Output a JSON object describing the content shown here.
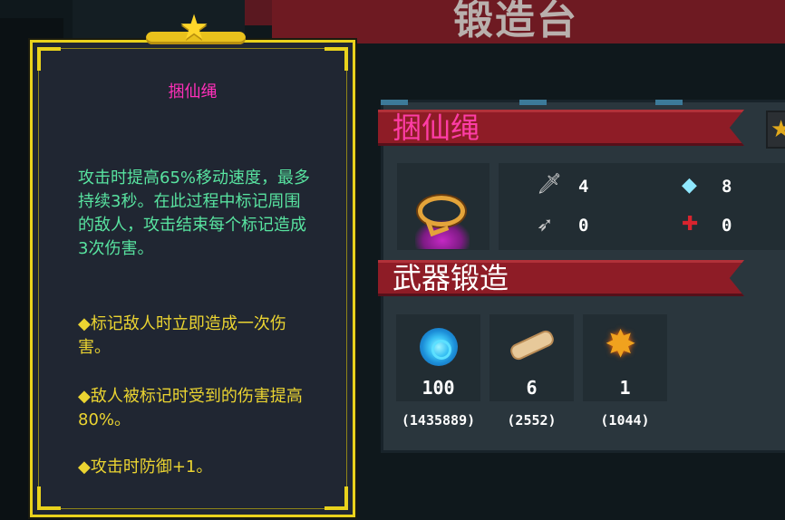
{
  "screen": {
    "header_title": "锻造台"
  },
  "tooltip": {
    "title": "捆仙绳",
    "description": "攻击时提高65%移动速度，最多持续3秒。在此过程中标记周围的敌人，攻击结束每个标记造成3次伤害。",
    "bullets": [
      "◆标记敌人时立即造成一次伤害。",
      "◆敌人被标记时受到的伤害提高80%。",
      "◆攻击时防御+1。"
    ]
  },
  "item": {
    "name": "捆仙绳",
    "icon": "lasso-icon",
    "stats": [
      {
        "icon": "sword-icon",
        "value": "4"
      },
      {
        "icon": "diamond-icon",
        "value": "8"
      },
      {
        "icon": "dagger-icon",
        "value": "0"
      },
      {
        "icon": "crosshair-icon",
        "value": "0"
      }
    ]
  },
  "forge": {
    "section_title": "武器锻造",
    "materials": [
      {
        "icon": "gem-icon",
        "required": "100",
        "owned": "(1435889)"
      },
      {
        "icon": "wood-icon",
        "required": "6",
        "owned": "(2552)"
      },
      {
        "icon": "spark-icon",
        "required": "1",
        "owned": "(1044)"
      }
    ]
  },
  "colors": {
    "banner_red": "#8e1c26",
    "item_name_pink": "#ff3da6",
    "tooltip_gold": "#e9d21c",
    "description_green": "#58e3a0",
    "bullet_yellow": "#ebd431"
  }
}
